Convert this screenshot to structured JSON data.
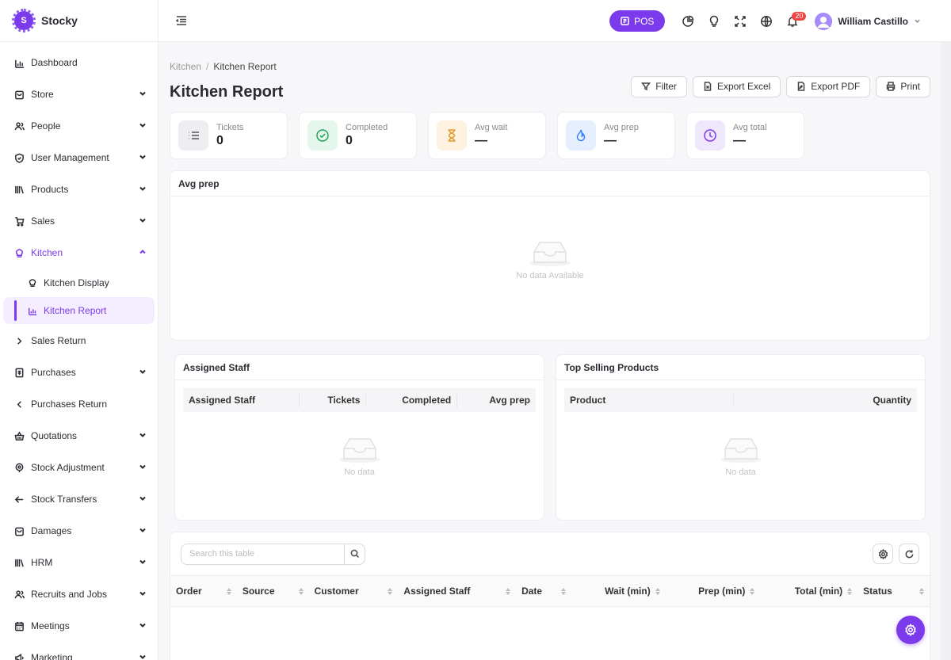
{
  "app": {
    "name": "Stocky"
  },
  "sidebar": {
    "items": [
      {
        "label": "Dashboard",
        "icon": "bar-chart-icon",
        "expandable": false
      },
      {
        "label": "Store",
        "icon": "store-icon",
        "expandable": true
      },
      {
        "label": "People",
        "icon": "people-icon",
        "expandable": true
      },
      {
        "label": "User Management",
        "icon": "shield-icon",
        "expandable": true
      },
      {
        "label": "Products",
        "icon": "books-icon",
        "expandable": true
      },
      {
        "label": "Sales",
        "icon": "cart-icon",
        "expandable": true
      },
      {
        "label": "Kitchen",
        "icon": "chef-hat-icon",
        "expandable": true,
        "expanded": true
      },
      {
        "label": "Sales Return",
        "icon": "chevron-right-icon",
        "expandable": false
      },
      {
        "label": "Purchases",
        "icon": "receipt-icon",
        "expandable": true
      },
      {
        "label": "Purchases Return",
        "icon": "chevron-left-icon",
        "expandable": false
      },
      {
        "label": "Quotations",
        "icon": "basket-icon",
        "expandable": true
      },
      {
        "label": "Stock Adjustment",
        "icon": "target-icon",
        "expandable": true
      },
      {
        "label": "Stock Transfers",
        "icon": "arrow-left-icon",
        "expandable": true
      },
      {
        "label": "Damages",
        "icon": "box-icon",
        "expandable": true
      },
      {
        "label": "HRM",
        "icon": "library-icon",
        "expandable": true
      },
      {
        "label": "Recruits and Jobs",
        "icon": "people-icon",
        "expandable": true
      },
      {
        "label": "Meetings",
        "icon": "calendar-icon",
        "expandable": true
      },
      {
        "label": "Marketing",
        "icon": "megaphone-icon",
        "expandable": true
      }
    ],
    "kitchen_sub": [
      {
        "label": "Kitchen Display",
        "icon": "chef-hat-icon",
        "active": false
      },
      {
        "label": "Kitchen Report",
        "icon": "bar-chart-icon",
        "active": true
      }
    ]
  },
  "topbar": {
    "pos_label": "POS",
    "notification_count": "20",
    "user_name": "William Castillo"
  },
  "breadcrumb": {
    "parent": "Kitchen",
    "current": "Kitchen Report"
  },
  "page": {
    "title": "Kitchen Report"
  },
  "actions": {
    "filter": "Filter",
    "export_excel": "Export Excel",
    "export_pdf": "Export PDF",
    "print": "Print"
  },
  "stats": [
    {
      "label": "Tickets",
      "value": "0",
      "icon": "list-icon",
      "bg": "#eeeef2",
      "stroke": "#555"
    },
    {
      "label": "Completed",
      "value": "0",
      "icon": "check-circle-icon",
      "bg": "#e5f6ec",
      "stroke": "#22a55a"
    },
    {
      "label": "Avg wait",
      "value": "—",
      "icon": "hourglass-icon",
      "bg": "#fdf1e0",
      "stroke": "#e59a2a"
    },
    {
      "label": "Avg prep",
      "value": "—",
      "icon": "flame-icon",
      "bg": "#e6effd",
      "stroke": "#3b82f6"
    },
    {
      "label": "Avg total",
      "value": "—",
      "icon": "clock-icon",
      "bg": "#efe8fd",
      "stroke": "#7c3aed"
    }
  ],
  "avg_prep_card": {
    "title": "Avg prep",
    "empty": "No data Available"
  },
  "assigned_staff_card": {
    "title": "Assigned Staff",
    "columns": [
      "Assigned Staff",
      "Tickets",
      "Completed",
      "Avg prep"
    ],
    "empty": "No data"
  },
  "top_selling_card": {
    "title": "Top Selling Products",
    "columns": [
      "Product",
      "Quantity"
    ],
    "empty": "No data"
  },
  "orders_table": {
    "search_placeholder": "Search this table",
    "columns": [
      "Order",
      "Source",
      "Customer",
      "Assigned Staff",
      "Date",
      "Wait (min)",
      "Prep (min)",
      "Total (min)",
      "Status"
    ]
  },
  "colors": {
    "accent": "#7c3aed",
    "badge": "#ef4444"
  }
}
